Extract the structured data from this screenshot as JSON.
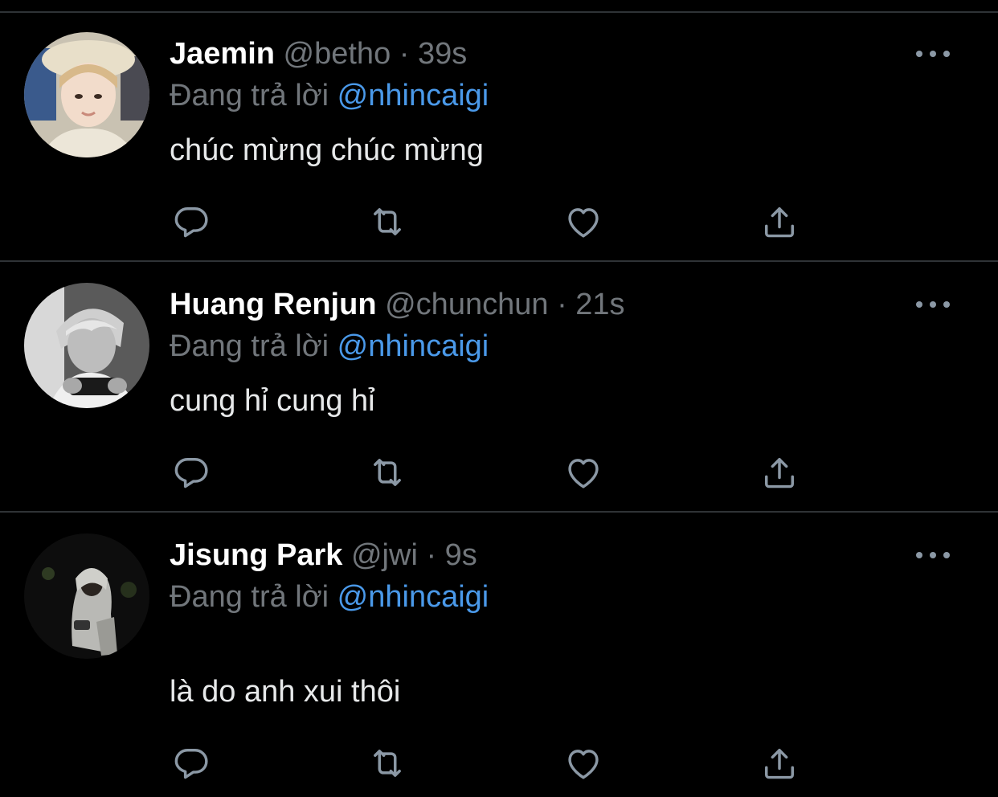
{
  "colors": {
    "background": "#000000",
    "divider": "#2f3336",
    "secondary_text": "#71767b",
    "mention": "#4a99e9",
    "icon": "#8b98a5"
  },
  "tweets": [
    {
      "display_name": "Jaemin",
      "handle": "@betho",
      "separator": "·",
      "timestamp": "39s",
      "reply_prefix": "Đang trả lời",
      "reply_to": "@nhincaigi",
      "text": "chúc mừng chúc mừng",
      "avatar_icon": "avatar-photo"
    },
    {
      "display_name": "Huang Renjun",
      "handle": "@chunchun",
      "separator": "·",
      "timestamp": "21s",
      "reply_prefix": "Đang trả lời",
      "reply_to": "@nhincaigi",
      "text": "cung hỉ cung hỉ",
      "avatar_icon": "avatar-photo"
    },
    {
      "display_name": "Jisung Park",
      "handle": "@jwi",
      "separator": "·",
      "timestamp": "9s",
      "reply_prefix": "Đang trả lời",
      "reply_to": "@nhincaigi",
      "text": "là do anh xui thôi",
      "avatar_icon": "avatar-photo"
    }
  ],
  "actions": [
    "reply-icon",
    "retweet-icon",
    "like-icon",
    "share-icon"
  ]
}
